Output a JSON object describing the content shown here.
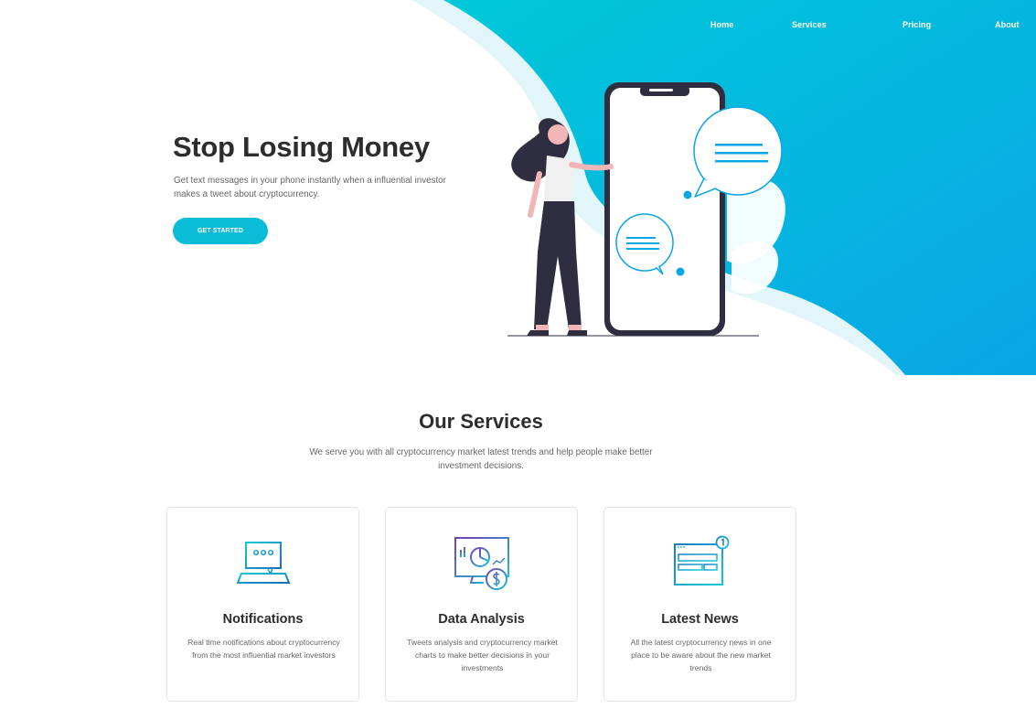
{
  "nav": {
    "items": [
      {
        "label": "Home"
      },
      {
        "label": "Services"
      },
      {
        "label": "Pricing"
      },
      {
        "label": "About"
      }
    ]
  },
  "hero": {
    "title": "Stop Losing Money",
    "subtitle": "Get text messages in your phone instantly when a influential investor makes a tweet about cryptocurrency.",
    "cta_label": "GET STARTED"
  },
  "services": {
    "title": "Our Services",
    "subtitle": "We serve you with all cryptocurrency market latest trends and help people make better investment decisions.",
    "cards": [
      {
        "title": "Notifications",
        "text": "Real time notifications about cryptocurrency from the most influential market investors",
        "icon": "laptop-chat-icon"
      },
      {
        "title": "Data Analysis",
        "text": "Tweets analysis and cryptocurrency market charts to make better decisions in your investments",
        "icon": "monitor-chart-dollar-icon"
      },
      {
        "title": "Latest News",
        "text": "All the latest cryptocurrency news in one place to be aware about the new market trends",
        "icon": "browser-news-icon"
      }
    ]
  },
  "colors": {
    "accent": "#0bbcd8",
    "gradient_start": "#00c6d9",
    "gradient_end": "#0aa3e8",
    "text_dark": "#2d2d2d"
  }
}
